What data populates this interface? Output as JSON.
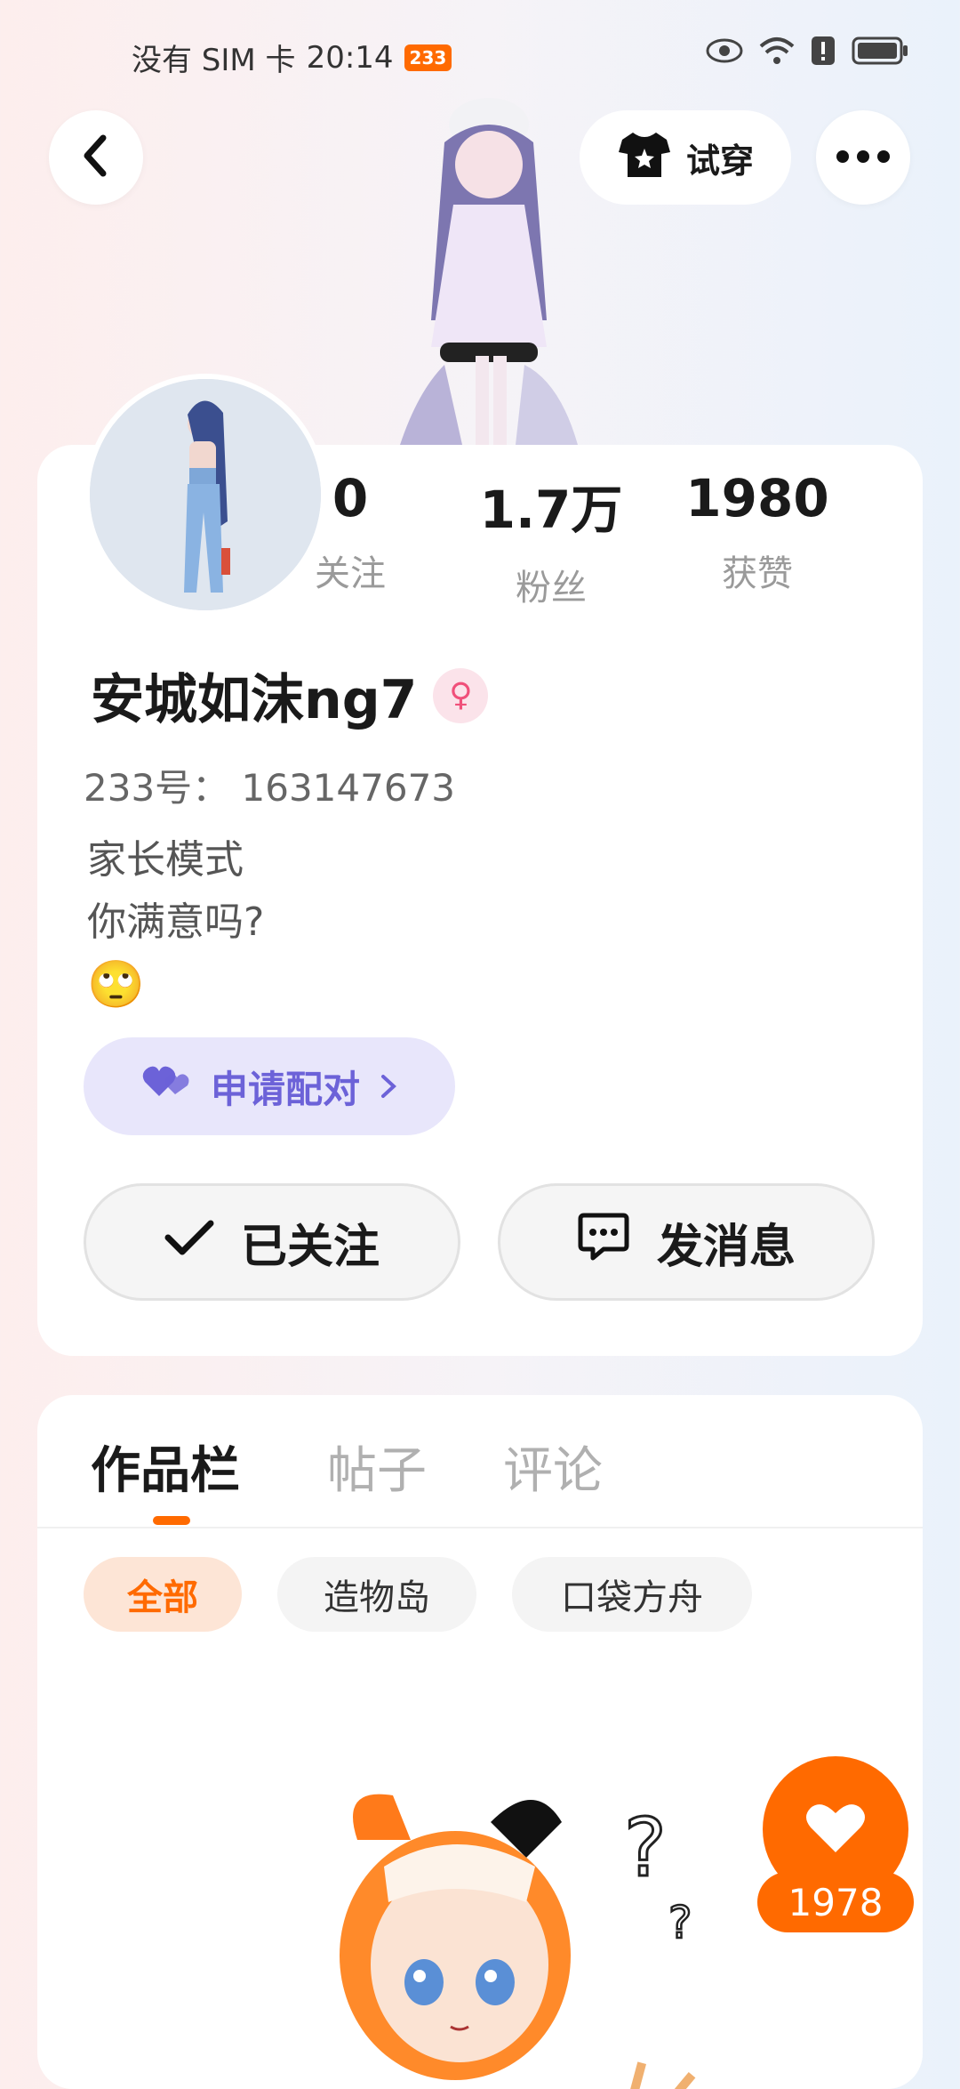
{
  "status_bar": {
    "carrier": "没有 SIM 卡",
    "time": "20:14",
    "badge": "233",
    "icons": [
      "eye-icon",
      "wifi-icon",
      "alert-icon",
      "battery-icon"
    ]
  },
  "top_bar": {
    "back_icon": "chevron-left-icon",
    "try_on_label": "试穿",
    "more_icon": "more-dots-icon"
  },
  "profile": {
    "stats": [
      {
        "value": "0",
        "label": "关注"
      },
      {
        "value": "1.7万",
        "label": "粉丝"
      },
      {
        "value": "1980",
        "label": "获赞"
      }
    ],
    "name": "安城如沫ng7",
    "gender_icon": "female-icon",
    "uid": "233号： 163147673",
    "bio_line1": "家长模式",
    "bio_line2": "你满意吗?",
    "bio_emoji": "🙄",
    "pair_label": "申请配对",
    "follow_label": "已关注",
    "message_label": "发消息"
  },
  "works": {
    "tabs": [
      "作品栏",
      "帖子",
      "评论"
    ],
    "active_tab": "作品栏",
    "chips": [
      "全部",
      "造物岛",
      "口袋方舟"
    ],
    "active_chip": "全部",
    "like_count": "1978"
  },
  "colors": {
    "accent": "#ff6a00",
    "pair_purple": "#6c62d8"
  }
}
